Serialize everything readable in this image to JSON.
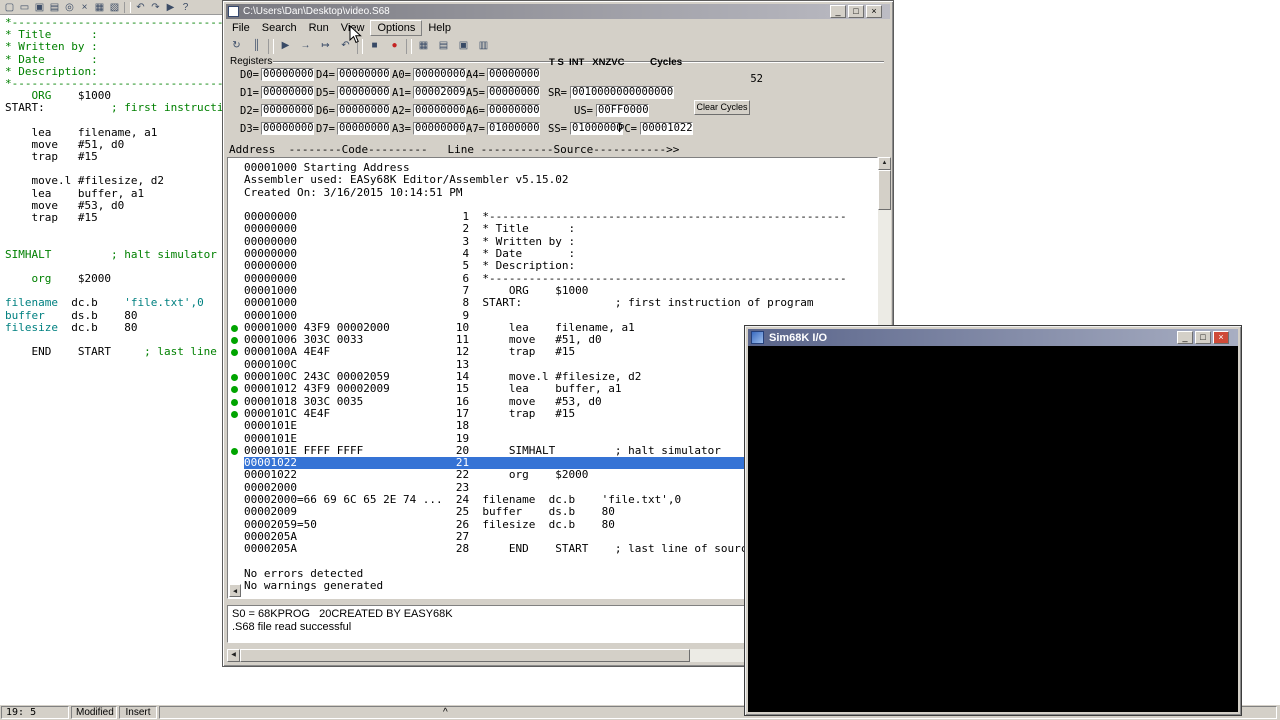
{
  "editor": {
    "toolbar_icons": [
      {
        "name": "new-file-icon",
        "glyph": "▢"
      },
      {
        "name": "open-file-icon",
        "glyph": "▭"
      },
      {
        "name": "save-file-icon",
        "glyph": "▣"
      },
      {
        "name": "print-icon",
        "glyph": "▤"
      },
      {
        "name": "find-icon",
        "glyph": "◎"
      },
      {
        "name": "cut-icon",
        "glyph": "×"
      },
      {
        "name": "copy-icon",
        "glyph": "▦"
      },
      {
        "name": "paste-icon",
        "glyph": "▧"
      },
      {
        "name": "toolbar-separator",
        "sep": true
      },
      {
        "name": "undo-icon",
        "glyph": "↶"
      },
      {
        "name": "redo-icon",
        "glyph": "↷"
      },
      {
        "name": "assemble-icon",
        "glyph": "▶"
      },
      {
        "name": "help-icon",
        "glyph": "?"
      }
    ],
    "lines": [
      [
        {
          "t": "*------------------------------------------------------",
          "c": "cm"
        }
      ],
      [
        {
          "t": "* Title      :",
          "c": "cm"
        }
      ],
      [
        {
          "t": "* Written by :",
          "c": "cm"
        }
      ],
      [
        {
          "t": "* Date       :",
          "c": "cm"
        }
      ],
      [
        {
          "t": "* Description:",
          "c": "cm"
        }
      ],
      [
        {
          "t": "*------------------------------------------------------",
          "c": "cm"
        }
      ],
      [
        {
          "t": "    ",
          "c": "tx"
        },
        {
          "t": "ORG",
          "c": "dir"
        },
        {
          "t": "    $1000",
          "c": "tx"
        }
      ],
      [
        {
          "t": "START:          ",
          "c": "tx"
        },
        {
          "t": "; first instruction of program",
          "c": "cm"
        }
      ],
      [],
      [
        {
          "t": "    lea    filename, a1",
          "c": "tx"
        }
      ],
      [
        {
          "t": "    move   #51, d0",
          "c": "tx"
        }
      ],
      [
        {
          "t": "    trap   #15",
          "c": "tx"
        }
      ],
      [],
      [
        {
          "t": "    move.l #filesize, d2",
          "c": "tx"
        }
      ],
      [
        {
          "t": "    lea    buffer, a1",
          "c": "tx"
        }
      ],
      [
        {
          "t": "    move   #53, d0",
          "c": "tx"
        }
      ],
      [
        {
          "t": "    trap   #15",
          "c": "tx"
        }
      ],
      [],
      [],
      [
        {
          "t": "SIMHALT",
          "c": "dir"
        },
        {
          "t": "         ",
          "c": "tx"
        },
        {
          "t": "; halt simulator",
          "c": "cm"
        }
      ],
      [],
      [
        {
          "t": "    ",
          "c": "tx"
        },
        {
          "t": "org",
          "c": "dir"
        },
        {
          "t": "    $2000",
          "c": "tx"
        }
      ],
      [],
      [
        {
          "t": "filename",
          "c": "id"
        },
        {
          "t": "  dc.b    ",
          "c": "tx"
        },
        {
          "t": "'file.txt',0",
          "c": "id"
        }
      ],
      [
        {
          "t": "buffer",
          "c": "id"
        },
        {
          "t": "    ds.b    80",
          "c": "tx"
        }
      ],
      [
        {
          "t": "filesize",
          "c": "id"
        },
        {
          "t": "  dc.b    80",
          "c": "tx"
        }
      ],
      [],
      [
        {
          "t": "    END    START     ",
          "c": "tx"
        },
        {
          "t": "; last line of source",
          "c": "cm"
        }
      ]
    ],
    "status": {
      "cursor": "19: 5",
      "modified": "Modified",
      "insert_mode": "Insert",
      "caret": "^"
    }
  },
  "sim": {
    "title": "C:\\Users\\Dan\\Desktop\\video.S68",
    "window_buttons": [
      {
        "name": "minimize-button",
        "glyph": "_"
      },
      {
        "name": "maximize-button",
        "glyph": "□"
      },
      {
        "name": "close-button",
        "glyph": "×"
      }
    ],
    "menu": [
      "File",
      "Search",
      "Run",
      "View",
      "Options",
      "Help"
    ],
    "menu_hover": "Options",
    "toolbar_icons": [
      {
        "name": "reload-icon",
        "glyph": "↻"
      },
      {
        "name": "pause-icon",
        "glyph": "║"
      },
      {
        "name": "toolbar-separator",
        "sep": true
      },
      {
        "name": "run-icon",
        "glyph": "▶"
      },
      {
        "name": "trace-icon",
        "glyph": "→"
      },
      {
        "name": "stepover-icon",
        "glyph": "↦"
      },
      {
        "name": "rewind-icon",
        "glyph": "↶"
      },
      {
        "name": "toolbar-separator",
        "sep": true
      },
      {
        "name": "stop-icon",
        "glyph": "■"
      },
      {
        "name": "breakpoint-icon",
        "glyph": "●",
        "color": "#c42222"
      },
      {
        "name": "toolbar-separator",
        "sep": true
      },
      {
        "name": "memory-icon",
        "glyph": "▦"
      },
      {
        "name": "stack-icon",
        "glyph": "▤"
      },
      {
        "name": "hardware-icon",
        "glyph": "▣"
      },
      {
        "name": "io-icon",
        "glyph": "▥"
      }
    ],
    "registers": {
      "panel_label": "Registers",
      "rows": [
        [
          {
            "l": "D0",
            "v": "00000000"
          },
          {
            "l": "D4",
            "v": "00000000"
          },
          {
            "l": "A0",
            "v": "00000000"
          },
          {
            "l": "A4",
            "v": "00000000"
          }
        ],
        [
          {
            "l": "D1",
            "v": "00000000"
          },
          {
            "l": "D5",
            "v": "00000000"
          },
          {
            "l": "A1",
            "v": "00002009"
          },
          {
            "l": "A5",
            "v": "00000000"
          }
        ],
        [
          {
            "l": "D2",
            "v": "00000000"
          },
          {
            "l": "D6",
            "v": "00000000"
          },
          {
            "l": "A2",
            "v": "00000000"
          },
          {
            "l": "A6",
            "v": "00000000"
          }
        ],
        [
          {
            "l": "D3",
            "v": "00000000"
          },
          {
            "l": "D7",
            "v": "00000000"
          },
          {
            "l": "A3",
            "v": "00000000"
          },
          {
            "l": "A7",
            "v": "01000000"
          }
        ]
      ],
      "flags_header": "T S  INT   XNZVC",
      "sr_label": "SR=",
      "sr": "0010000000000000",
      "us_label": "US=",
      "us": "00FF0000",
      "ss_label": "SS=",
      "ss": "01000000",
      "pc_label": "PC=",
      "pc": "00001022",
      "cycles_label": "Cycles",
      "cycles": "52",
      "clear_cycles_label": "Clear Cycles"
    },
    "listing_header": "Address  --------Code---------   Line -----------Source----------->>",
    "listing": [
      {
        "raw": "00001000 Starting Address"
      },
      {
        "raw": "Assembler used: EASy68K Editor/Assembler v5.15.02"
      },
      {
        "raw": "Created On: 3/16/2015 10:14:51 PM"
      },
      {
        "raw": ""
      },
      {
        "addr": "00000000",
        "line": "1",
        "src": "*------------------------------------------------------"
      },
      {
        "addr": "00000000",
        "line": "2",
        "src": "* Title      :"
      },
      {
        "addr": "00000000",
        "line": "3",
        "src": "* Written by :"
      },
      {
        "addr": "00000000",
        "line": "4",
        "src": "* Date       :"
      },
      {
        "addr": "00000000",
        "line": "5",
        "src": "* Description:"
      },
      {
        "addr": "00000000",
        "line": "6",
        "src": "*------------------------------------------------------"
      },
      {
        "addr": "00001000",
        "line": "7",
        "src": "    ORG    $1000"
      },
      {
        "addr": "00001000",
        "line": "8",
        "src": "START:              ; first instruction of program"
      },
      {
        "addr": "00001000",
        "line": "9",
        "src": ""
      },
      {
        "addr": "00001000",
        "code": "43F9 00002000",
        "line": "10",
        "src": "    lea    filename, a1",
        "dot": true
      },
      {
        "addr": "00001006",
        "code": "303C 0033",
        "line": "11",
        "src": "    move   #51, d0",
        "dot": true
      },
      {
        "addr": "0000100A",
        "code": "4E4F",
        "line": "12",
        "src": "    trap   #15",
        "dot": true
      },
      {
        "addr": "0000100C",
        "line": "13",
        "src": ""
      },
      {
        "addr": "0000100C",
        "code": "243C 00002059",
        "line": "14",
        "src": "    move.l #filesize, d2",
        "dot": true
      },
      {
        "addr": "00001012",
        "code": "43F9 00002009",
        "line": "15",
        "src": "    lea    buffer, a1",
        "dot": true
      },
      {
        "addr": "00001018",
        "code": "303C 0035",
        "line": "16",
        "src": "    move   #53, d0",
        "dot": true
      },
      {
        "addr": "0000101C",
        "code": "4E4F",
        "line": "17",
        "src": "    trap   #15",
        "dot": true
      },
      {
        "addr": "0000101E",
        "line": "18",
        "src": ""
      },
      {
        "addr": "0000101E",
        "line": "19",
        "src": ""
      },
      {
        "addr": "0000101E",
        "code": "FFFF FFFF",
        "line": "20",
        "src": "    SIMHALT         ; halt simulator",
        "dot": true
      },
      {
        "addr": "00001022",
        "line": "21",
        "src": "",
        "hl": true
      },
      {
        "addr": "00001022",
        "line": "22",
        "src": "    org    $2000"
      },
      {
        "addr": "00002000",
        "line": "23",
        "src": ""
      },
      {
        "addr": "00002000=",
        "code": "66 69 6C 65 2E 74 ...",
        "line": "24",
        "src": "filename  dc.b    'file.txt',0"
      },
      {
        "addr": "00002009",
        "line": "25",
        "src": "buffer    ds.b    80"
      },
      {
        "addr": "00002059=",
        "code": "50",
        "line": "26",
        "src": "filesize  dc.b    80"
      },
      {
        "addr": "0000205A",
        "line": "27",
        "src": ""
      },
      {
        "addr": "0000205A",
        "line": "28",
        "src": "    END    START    ; last line of source"
      },
      {
        "raw": ""
      },
      {
        "raw": "No errors detected"
      },
      {
        "raw": "No warnings generated"
      }
    ],
    "status_lines": [
      "S0 = 68KPROG   20CREATED BY EASY68K",
      ".S68 file read successful"
    ],
    "scroll": {
      "up": "▲",
      "down": "▼",
      "left": "◀",
      "right": "▶"
    }
  },
  "io": {
    "title": "Sim68K I/O",
    "window_buttons": [
      {
        "name": "io-minimize-button",
        "glyph": "_"
      },
      {
        "name": "io-maximize-button",
        "glyph": "□"
      },
      {
        "name": "io-close-button",
        "glyph": "×",
        "close": true
      }
    ]
  }
}
